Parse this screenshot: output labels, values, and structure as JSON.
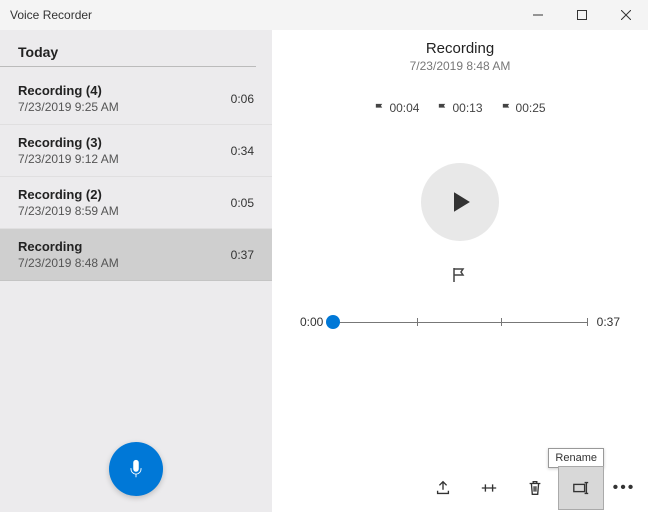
{
  "app_title": "Voice Recorder",
  "group_header": "Today",
  "recordings": [
    {
      "title": "Recording (4)",
      "timestamp": "7/23/2019 9:25 AM",
      "duration": "0:06",
      "selected": false
    },
    {
      "title": "Recording (3)",
      "timestamp": "7/23/2019 9:12 AM",
      "duration": "0:34",
      "selected": false
    },
    {
      "title": "Recording (2)",
      "timestamp": "7/23/2019 8:59 AM",
      "duration": "0:05",
      "selected": false
    },
    {
      "title": "Recording",
      "timestamp": "7/23/2019 8:48 AM",
      "duration": "0:37",
      "selected": true
    }
  ],
  "detail": {
    "title": "Recording",
    "timestamp": "7/23/2019 8:48 AM",
    "markers": [
      "00:04",
      "00:13",
      "00:25"
    ],
    "position": "0:00",
    "total": "0:37",
    "tick_positions_pct": [
      0,
      33,
      66,
      100
    ],
    "thumb_pct": 0
  },
  "tooltip": "Rename",
  "colors": {
    "accent": "#0078d7"
  }
}
